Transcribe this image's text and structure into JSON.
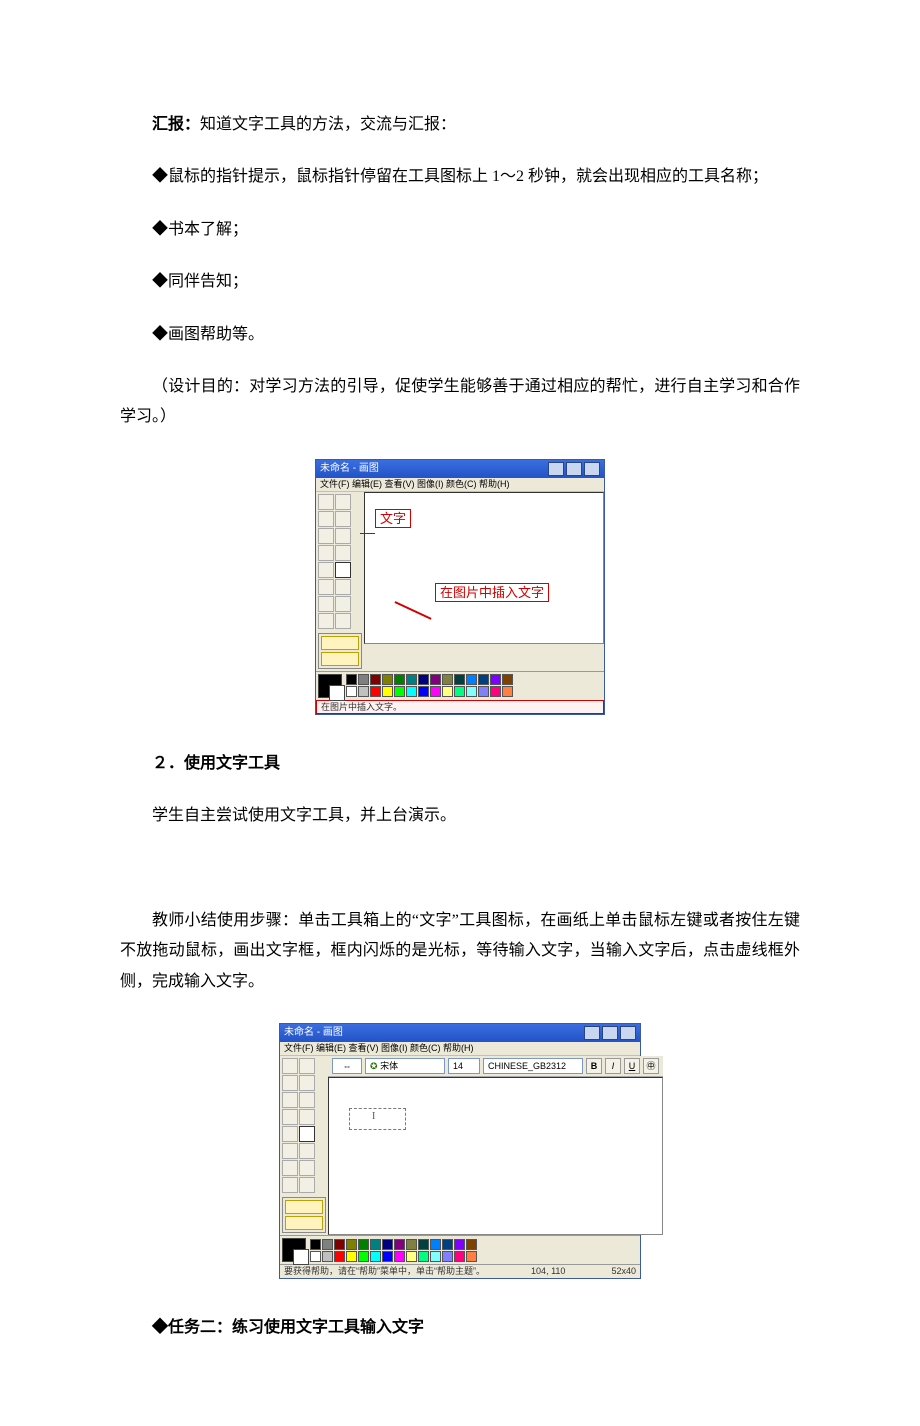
{
  "p_report": "汇报：",
  "p_report_rest": "知道文字工具的方法，交流与汇报：",
  "bullet_1": "◆鼠标的指针提示，鼠标指针停留在工具图标上 1～2 秒钟，就会出现相应的工具名称；",
  "bullet_2": "◆书本了解；",
  "bullet_3": "◆同伴告知；",
  "bullet_4": "◆画图帮助等。",
  "design_purpose": "（设计目的：对学习方法的引导，促使学生能够善于通过相应的帮忙，进行自主学习和合作学习。）",
  "fig1": {
    "title": "未命名 - 画图",
    "menubar": "文件(F) 编辑(E) 查看(V) 图像(I) 颜色(C) 帮助(H)",
    "callout_text_tool": "文字",
    "callout_insert_text": "在图片中插入文字",
    "status": "在图片中插入文字。"
  },
  "sec2_title": "２．使用文字工具",
  "sec2_p1": "学生自主尝试使用文字工具，并上台演示。",
  "sec2_p2": "教师小结使用步骤：单击工具箱上的“文字”工具图标，在画纸上单击鼠标左键或者按住左键不放拖动鼠标，画出文字框，框内闪烁的是光标，等待输入文字，当输入文字后，点击虚线框外侧，完成输入文字。",
  "fig2": {
    "title": "未命名 - 画图",
    "menubar": "文件(F) 编辑(E) 查看(V) 图像(I) 颜色(C) 帮助(H)",
    "font_name": "宋体",
    "font_script": "CHINESE_GB2312",
    "font_size": "14",
    "status_help": "要获得帮助，请在“帮助”菜单中，单击“帮助主题”。",
    "status_pos": "104, 110",
    "status_size": "52x40"
  },
  "task2_title": "◆任务二：练习使用文字工具输入文字",
  "palette_row1": [
    "#000000",
    "#808080",
    "#800000",
    "#808000",
    "#008000",
    "#008080",
    "#000080",
    "#800080",
    "#808040",
    "#004040",
    "#0080ff",
    "#004080",
    "#8000ff",
    "#804000"
  ],
  "palette_row2": [
    "#ffffff",
    "#c0c0c0",
    "#ff0000",
    "#ffff00",
    "#00ff00",
    "#00ffff",
    "#0000ff",
    "#ff00ff",
    "#ffff80",
    "#00ff80",
    "#80ffff",
    "#8080ff",
    "#ff0080",
    "#ff8040"
  ]
}
